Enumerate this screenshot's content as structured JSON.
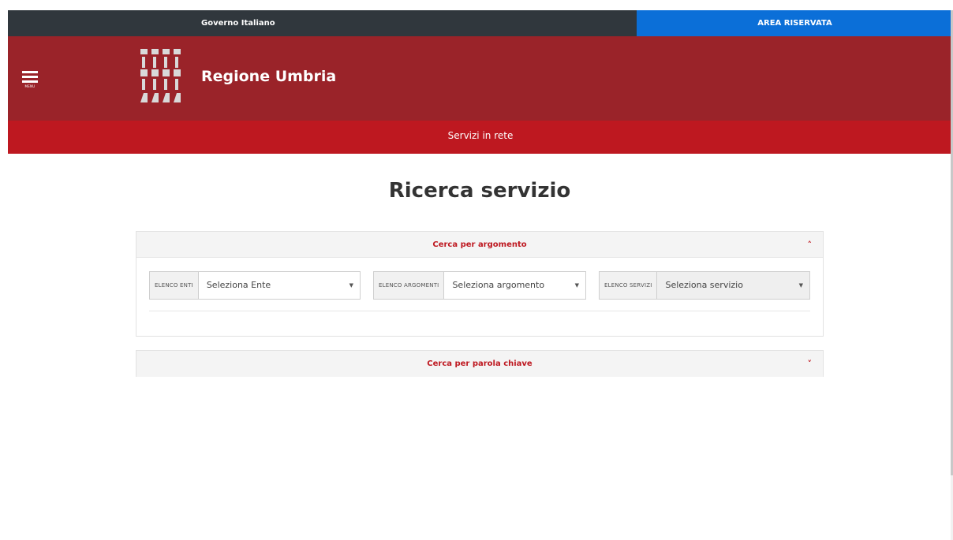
{
  "topbar": {
    "gov_label": "Governo Italiano",
    "reserved_label": "AREA RISERVATA"
  },
  "header": {
    "menu_label": "MENU",
    "site_title": "Regione Umbria"
  },
  "service_bar": {
    "label": "Servizi in rete"
  },
  "page": {
    "title": "Ricerca servizio"
  },
  "panels": {
    "argomento": {
      "title": "Cerca per argomento",
      "chevron": "chevron-up-icon",
      "selects": [
        {
          "addon": "ELENCO ENTI",
          "value": "Seleziona Ente"
        },
        {
          "addon": "ELENCO ARGOMENTI",
          "value": "Seleziona argomento"
        },
        {
          "addon": "ELENCO SERVIZI",
          "value": "Seleziona servizio"
        }
      ]
    },
    "parola": {
      "title": "Cerca per parola chiave",
      "chevron": "chevron-down-icon"
    }
  },
  "colors": {
    "topbar_dark": "#30373d",
    "reserved_blue": "#0b6fd8",
    "header_red": "#9a2329",
    "service_red": "#be1820",
    "accent_red": "#be1820"
  }
}
